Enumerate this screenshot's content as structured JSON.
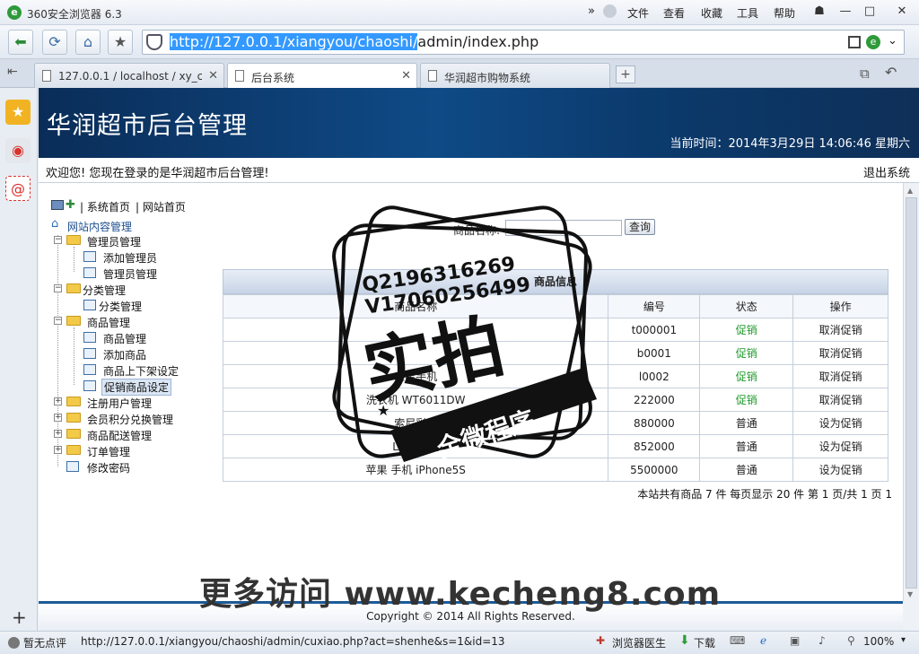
{
  "browser": {
    "title": "360安全浏览器 6.3",
    "menu": [
      "文件",
      "查看",
      "收藏",
      "工具",
      "帮助"
    ],
    "address_selected": "http://127.0.0.1/xiangyou/chaoshi/",
    "address_rest": "admin/index.php",
    "tabs": [
      {
        "label": "127.0.0.1 / localhost / xy_ch"
      },
      {
        "label": "后台系统"
      },
      {
        "label": "华润超市购物系统"
      }
    ],
    "status_left": "暂无点评",
    "status_url": "http://127.0.0.1/xiangyou/chaoshi/admin/cuxiao.php?act=shenhe&s=1&id=13",
    "status_items": [
      "浏览器医生",
      "下载"
    ],
    "zoom": "100%"
  },
  "page": {
    "title": "华润超市后台管理",
    "time": "当前时间：2014年3月29日  14:06:46 星期六",
    "welcome": "欢迎您! 您现在登录的是华润超市后台管理!",
    "logout": "退出系统",
    "footer": "Copyright © 2014 All Rights Reserved."
  },
  "leftnav": {
    "top_links": [
      "| 系统首页",
      "| 网站首页"
    ],
    "root": "网站内容管理",
    "groups": [
      {
        "label": "管理员管理",
        "children": [
          "添加管理员",
          "管理员管理"
        ]
      },
      {
        "label": "分类管理",
        "children": [
          "分类管理"
        ]
      },
      {
        "label": "商品管理",
        "children": [
          "商品管理",
          "添加商品",
          "商品上下架设定",
          "促销商品设定"
        ]
      }
    ],
    "collapsed": [
      "注册用户管理",
      "会员积分兑换管理",
      "商品配送管理",
      "订单管理"
    ],
    "change_password": "修改密码"
  },
  "search": {
    "label": "商品名称:",
    "button": "查询"
  },
  "table": {
    "caption": "商品信息",
    "headers": [
      "商品名称",
      "编号",
      "状态",
      "操作"
    ],
    "rows": [
      {
        "name": "",
        "code": "t000001",
        "status": "促销",
        "action": "取消促销"
      },
      {
        "name": "",
        "code": "b0001",
        "status": "促销",
        "action": "取消促销"
      },
      {
        "name": "三星手机",
        "code": "l0002",
        "status": "促销",
        "action": "取消促销"
      },
      {
        "name": "洗衣机 WT6011DW",
        "code": "222000",
        "status": "促销",
        "action": "取消促销"
      },
      {
        "name": "索尼彩电",
        "code": "880000",
        "status": "普通",
        "action": "设为促销"
      },
      {
        "name": "LG洗衣机",
        "code": "852000",
        "status": "普通",
        "action": "设为促销"
      },
      {
        "name": "苹果 手机 iPhone5S",
        "code": "5500000",
        "status": "普通",
        "action": "设为促销"
      }
    ],
    "pagination": "本站共有商品 7 件 每页显示 20 件 第 1 页/共 1 页 1"
  },
  "watermark": {
    "qq": "Q2196316269",
    "v": "V17060256499",
    "big": "实拍",
    "sub": "全微程序",
    "bottom": "更多访问 www.kecheng8.com"
  },
  "colors": {
    "header_dark": "#0a2d58",
    "promo_green": "#1f9a2b",
    "accent": "#1c5a96"
  }
}
